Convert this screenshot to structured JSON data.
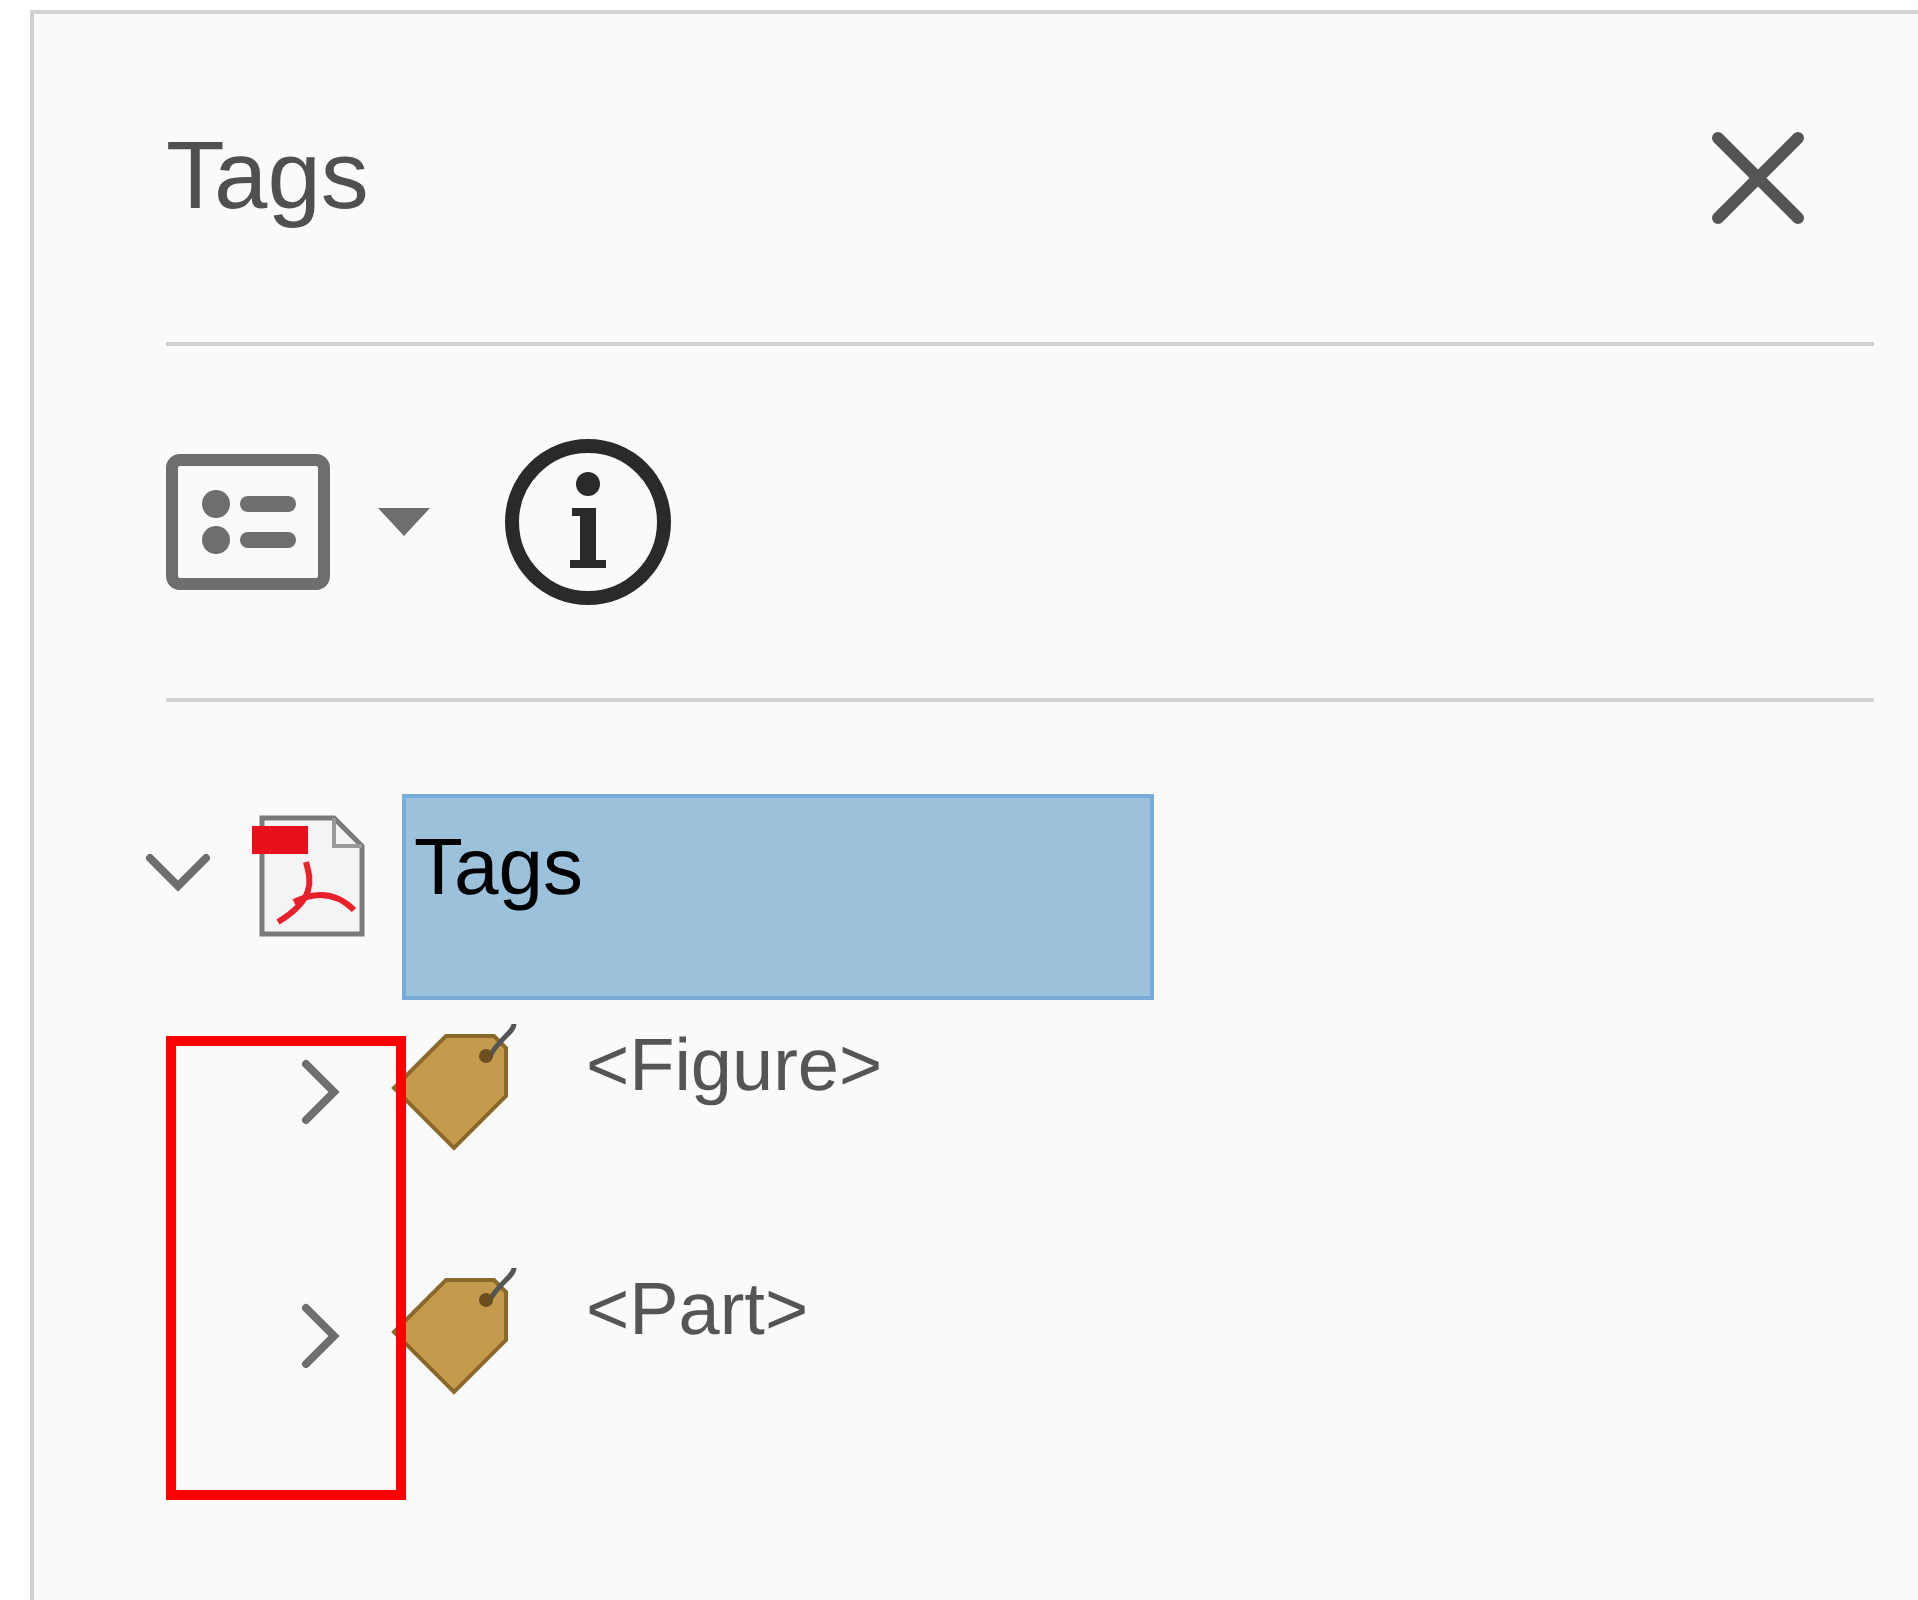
{
  "panel": {
    "title": "Tags"
  },
  "tree": [
    {
      "kind": "document",
      "label": "Tags",
      "expanded": true,
      "selected": true,
      "children": [
        {
          "kind": "tag",
          "label": "<Figure>",
          "expanded": false,
          "selected": false
        },
        {
          "kind": "tag",
          "label": "<Part>",
          "expanded": false,
          "selected": false
        }
      ]
    }
  ]
}
